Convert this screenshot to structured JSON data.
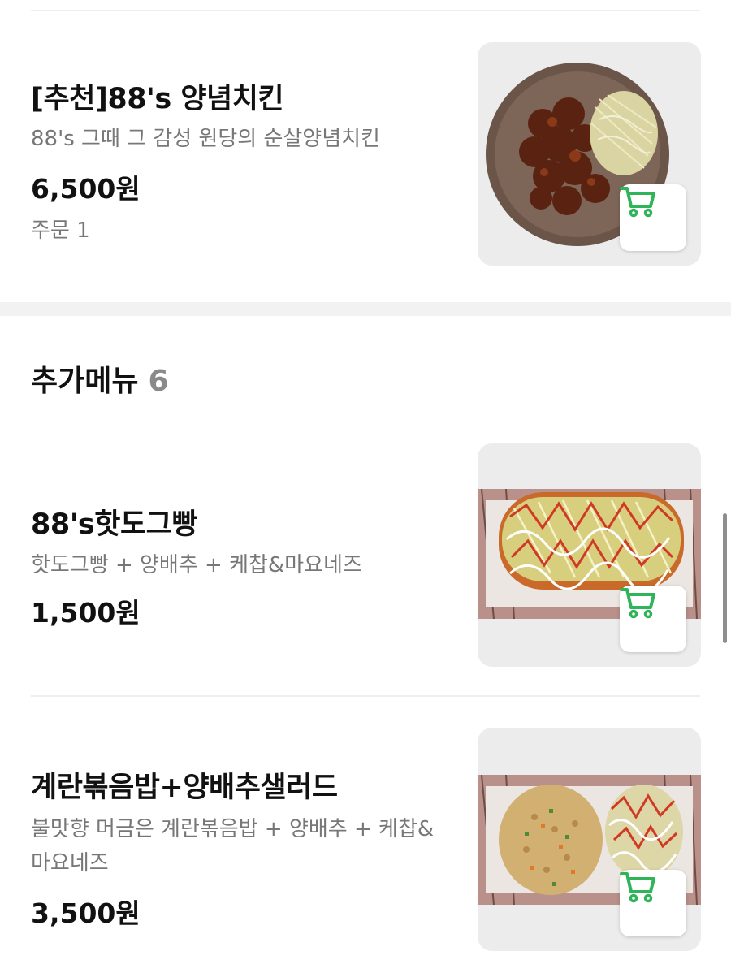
{
  "recommended_item": {
    "name": "[추천]88's 양념치킨",
    "description": "88's 그때 그 감성 원당의 순살양념치킨",
    "price": "6,500원",
    "orders": "주문 1"
  },
  "section": {
    "title": "추가메뉴",
    "count": "6"
  },
  "items": [
    {
      "name": "88's핫도그빵",
      "description": "핫도그빵 + 양배추 + 케찹&마요네즈",
      "price": "1,500원"
    },
    {
      "name": "계란볶음밥+양배추샐러드",
      "description": "불맛향 머금은 계란볶음밥 + 양배추 + 케찹&마요네즈",
      "price": "3,500원"
    }
  ],
  "icons": {
    "cart": "cart-icon"
  },
  "colors": {
    "accent": "#2fb45a",
    "text": "#111111",
    "muted": "#777777"
  }
}
